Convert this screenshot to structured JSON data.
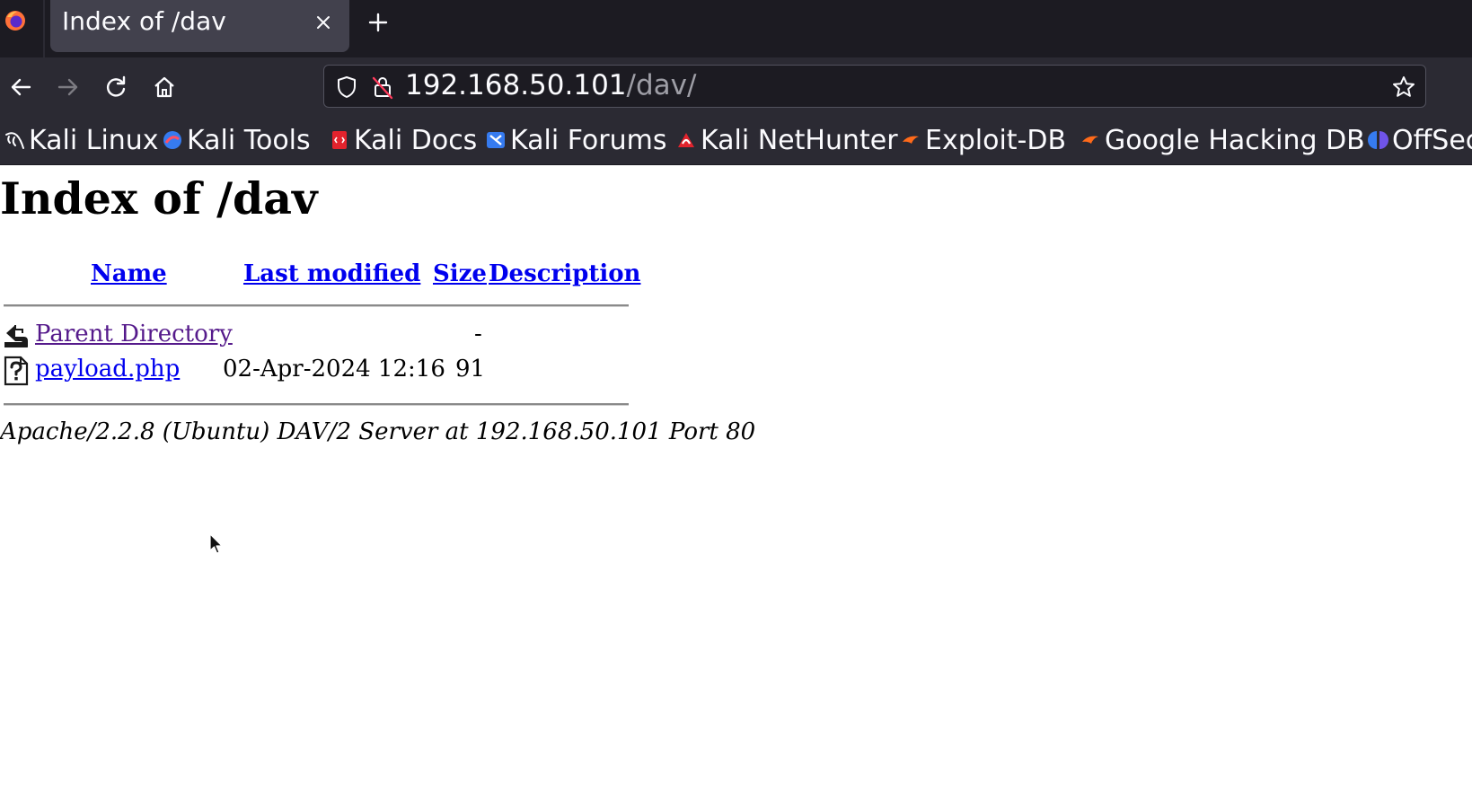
{
  "browser": {
    "tab": {
      "title": "Index of /dav",
      "close_symbol": "✕",
      "new_tab_symbol": "+"
    },
    "url": {
      "host": "192.168.50.101",
      "path": "/dav/"
    },
    "bookmarks": [
      {
        "label": "Kali Linux",
        "icon": "kali-dragon-icon"
      },
      {
        "label": "Kali Tools",
        "icon": "kali-tools-icon"
      },
      {
        "label": "Kali Docs",
        "icon": "kali-docs-icon"
      },
      {
        "label": "Kali Forums",
        "icon": "kali-forums-icon"
      },
      {
        "label": "Kali NetHunter",
        "icon": "kali-nethunter-icon"
      },
      {
        "label": "Exploit-DB",
        "icon": "exploit-db-icon"
      },
      {
        "label": "Google Hacking DB",
        "icon": "google-hacking-db-icon"
      },
      {
        "label": "OffSec",
        "icon": "offsec-icon"
      }
    ]
  },
  "page": {
    "title": "Index of /dav",
    "columns": {
      "name": "Name",
      "last_modified": "Last modified",
      "size": "Size",
      "description": "Description"
    },
    "rows": [
      {
        "name": "Parent Directory",
        "last_modified": "",
        "size": "-",
        "description": "",
        "icon": "back-folder-icon",
        "visited": true
      },
      {
        "name": "payload.php",
        "last_modified": "02-Apr-2024 12:16",
        "size": "91",
        "description": "",
        "icon": "unknown-file-icon",
        "visited": false
      }
    ],
    "footer": "Apache/2.2.8 (Ubuntu) DAV/2 Server at 192.168.50.101 Port 80"
  },
  "colors": {
    "tabstrip_bg": "#1c1b22",
    "toolbar_bg": "#2b2a33",
    "link": "#0000ee",
    "visited_link": "#551a8b"
  }
}
